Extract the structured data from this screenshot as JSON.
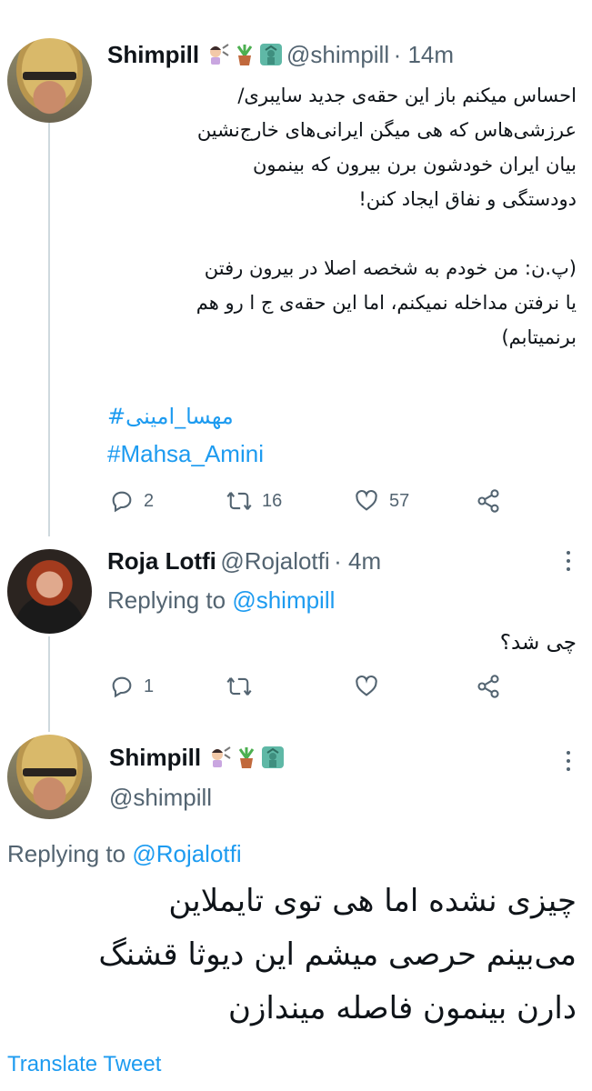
{
  "tweet1": {
    "name": "Shimpill",
    "handle": "@shimpill",
    "time": "· 14m",
    "body": "احساس میکنم باز این حقه‌ی جدید سایبری/\nعرزشی‌هاس که هی میگن ایرانی‌های خارج‌نشین\nبیان ایران خودشون برن بیرون که بینمون\nدودستگی و نفاق ایجاد کنن!\n\n(پ.ن: من خودم به شخصه اصلا در بیرون رفتن\nیا نرفتن مداخله نمیکنم، اما این حقه‌ی ج ا رو هم\nبرنمیتابم)",
    "hashtag_fa": "#مهسا_امینی",
    "hashtag_en": "#Mahsa_Amini",
    "replies": "2",
    "retweets": "16",
    "likes": "57"
  },
  "tweet2": {
    "name": "Roja Lotfi",
    "handle": "@Rojalotfi",
    "time": "· 4m",
    "replying_prefix": "Replying to",
    "replying_to": "@shimpill",
    "body": "چی شد؟",
    "replies": "1",
    "retweets": "",
    "likes": ""
  },
  "tweet3": {
    "name": "Shimpill",
    "handle": "@shimpill",
    "replying_prefix": "Replying to",
    "replying_to": "@Rojalotfi",
    "body": "چیزی نشده اما هی توی تایملاین\nمی‌بینم حرصی میشم این دیوثا قشنگ\nدارن بینمون فاصله میندازن",
    "translate": "Translate Tweet"
  },
  "colors": {
    "accent": "#1d9bf0",
    "secondary": "#536471",
    "text": "#0f1419"
  },
  "icons": [
    "reply-icon",
    "retweet-icon",
    "like-icon",
    "share-icon",
    "more-icon",
    "scissors-emoji-icon",
    "potted-plant-emoji-icon",
    "statue-of-liberty-emoji-icon"
  ]
}
